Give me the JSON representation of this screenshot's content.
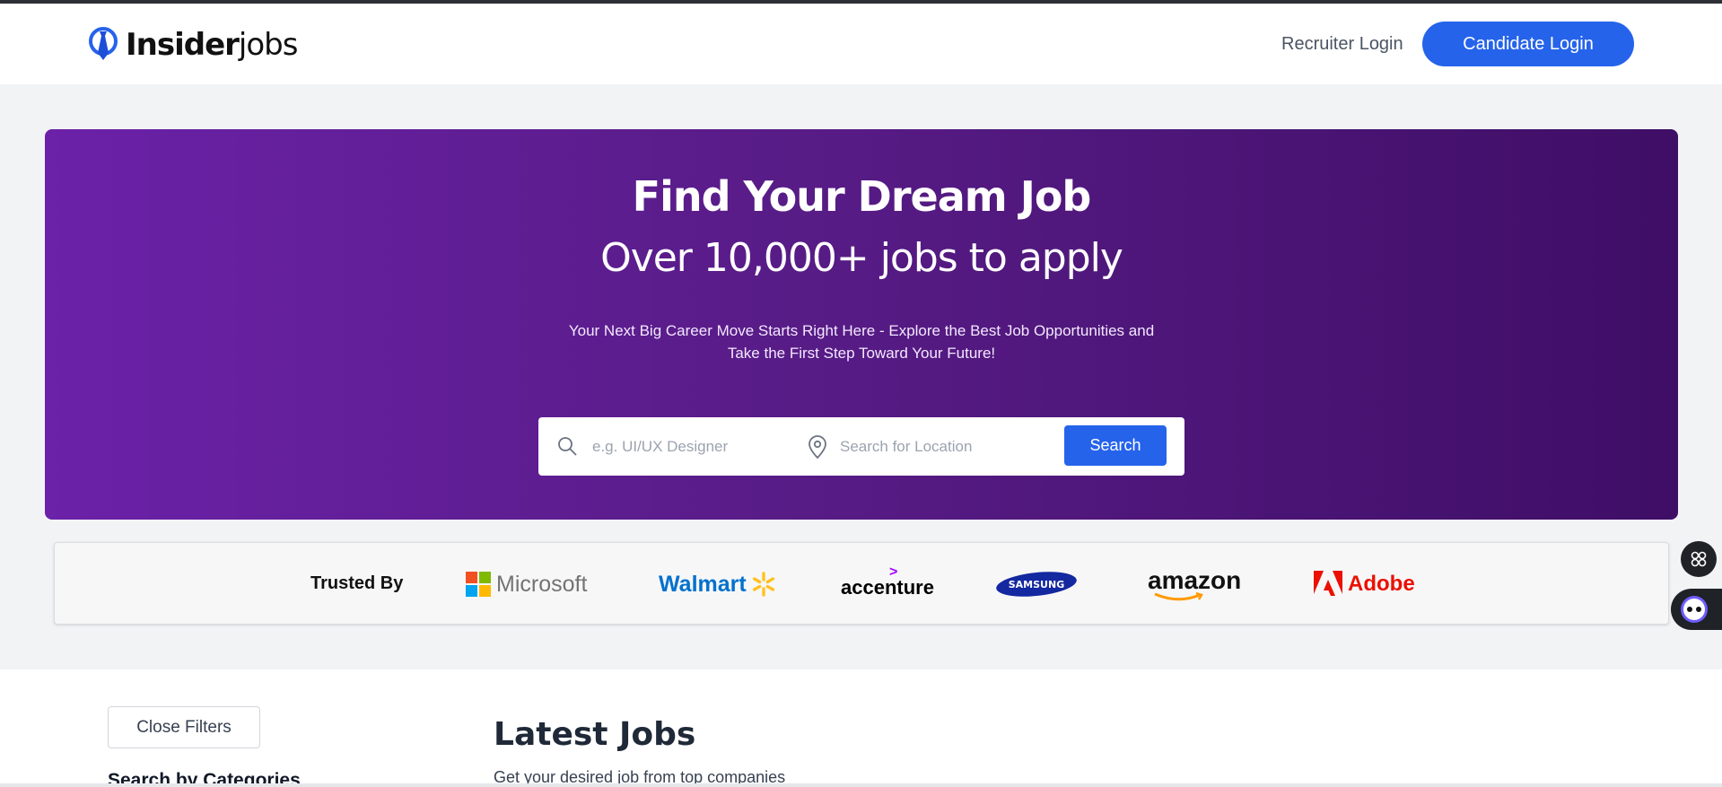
{
  "header": {
    "brand_bold": "Insider",
    "brand_light": "jobs",
    "recruiter_login": "Recruiter Login",
    "candidate_login": "Candidate Login"
  },
  "hero": {
    "title": "Find Your Dream Job",
    "subtitle": "Over 10,000+ jobs to apply",
    "description_line1": "Your Next Big Career Move Starts Right Here - Explore the Best Job Opportunities and",
    "description_line2": "Take the First Step Toward Your Future!",
    "search": {
      "job_placeholder": "e.g. UI/UX Designer",
      "location_placeholder": "Search for Location",
      "button_label": "Search"
    }
  },
  "trusted": {
    "label": "Trusted By",
    "brands": {
      "microsoft": "Microsoft",
      "walmart": "Walmart",
      "accenture": "accenture",
      "samsung": "SAMSUNG",
      "amazon": "amazon",
      "adobe": "Adobe"
    }
  },
  "filters": {
    "close_label": "Close Filters",
    "categories_heading": "Search by Categories"
  },
  "jobs": {
    "title": "Latest Jobs",
    "subtitle": "Get your desired job from top companies"
  },
  "colors": {
    "primary": "#2563eb",
    "hero_start": "#6b21a8",
    "hero_end": "#3f0e66"
  }
}
